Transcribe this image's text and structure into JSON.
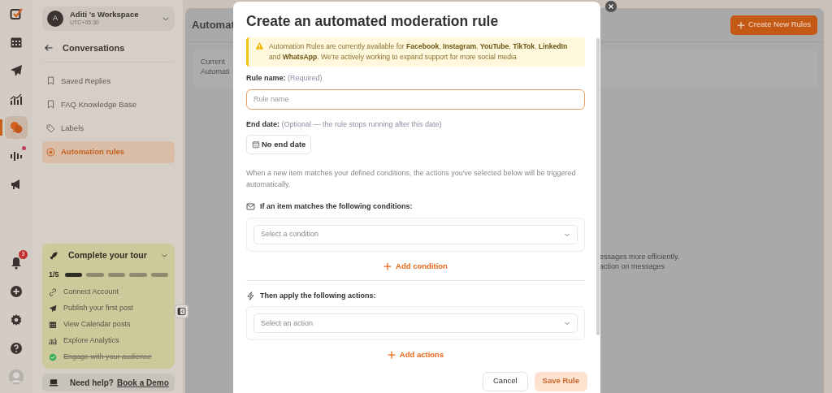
{
  "rail": {
    "top": [
      {
        "kind": "brand",
        "selected": false,
        "dot": false
      },
      {
        "kind": "calendar",
        "selected": false,
        "dot": false
      },
      {
        "kind": "send",
        "selected": false,
        "dot": false
      },
      {
        "kind": "analytics",
        "selected": false,
        "dot": false
      },
      {
        "kind": "chat",
        "selected": true,
        "dot": false
      },
      {
        "kind": "audio",
        "selected": false,
        "dot": true
      },
      {
        "kind": "megaphone",
        "selected": false,
        "dot": false
      }
    ],
    "bottom": [
      {
        "kind": "bell",
        "badge": "3"
      },
      {
        "kind": "plus"
      },
      {
        "kind": "gear"
      },
      {
        "kind": "help"
      },
      {
        "kind": "avatar"
      }
    ]
  },
  "workspace": {
    "avatar": "A",
    "name": "Aditi 's Workspace",
    "timezone": "UTC+05:30"
  },
  "sidebar": {
    "back_title": "Conversations",
    "items": [
      {
        "kind": "bookmark",
        "label": "Saved Replies",
        "selected": false
      },
      {
        "kind": "bookmark",
        "label": "FAQ Knowledge Base",
        "selected": false
      },
      {
        "kind": "tag",
        "label": "Labels",
        "selected": false
      },
      {
        "kind": "target",
        "label": "Automation rules",
        "selected": true
      }
    ]
  },
  "tour": {
    "title": "Complete your tour",
    "progress_text": "1/5",
    "segments": [
      {
        "done": true
      },
      {
        "done": false
      },
      {
        "done": false
      },
      {
        "done": false
      },
      {
        "done": false
      }
    ],
    "steps": [
      {
        "kind": "link",
        "label": "Connect Account",
        "done": false
      },
      {
        "kind": "send",
        "label": "Publish your first post",
        "done": false
      },
      {
        "kind": "calendar",
        "label": "View Calendar posts",
        "done": false
      },
      {
        "kind": "analytics",
        "label": "Explore Analytics",
        "done": false
      },
      {
        "kind": "check",
        "label": "Engage with your audience",
        "done": true
      }
    ]
  },
  "help": {
    "text": "Need help?",
    "link": "Book a Demo"
  },
  "main": {
    "title": "Automat",
    "create_button": "Create New Rules",
    "info_lines": [
      "Current",
      "Automati"
    ],
    "body_lines": [
      "essages more efficiently.",
      "action on messages"
    ]
  },
  "modal": {
    "title": "Create an automated moderation rule",
    "notice": "Automation Rules are currently available for **Facebook**, **Instagram**, **YouTube**, **TikTok**, **LinkedIn** and **WhatsApp**. We're actively working to expand support for more social media",
    "rule_name_label": "Rule name:",
    "rule_name_hint": "(Required)",
    "rule_name_placeholder": "Rule name",
    "end_date_label": "End date:",
    "end_date_hint": "(Optional — the rule stops running after this date)",
    "end_date_button": "No end date",
    "description": "When a new item matches your defined conditions, the actions you've selected below will be triggered automatically.",
    "sections": [
      {
        "kind": "conditions",
        "heading": "If an item matches the following conditions:",
        "placeholder": "Select a condition",
        "add_label": "Add condition"
      },
      {
        "kind": "actions",
        "heading": "Then apply the following actions:",
        "placeholder": "Select an action",
        "add_label": "Add actions"
      }
    ],
    "cancel": "Cancel",
    "save": {
      "label": "Save Rule",
      "disabled": true
    }
  }
}
